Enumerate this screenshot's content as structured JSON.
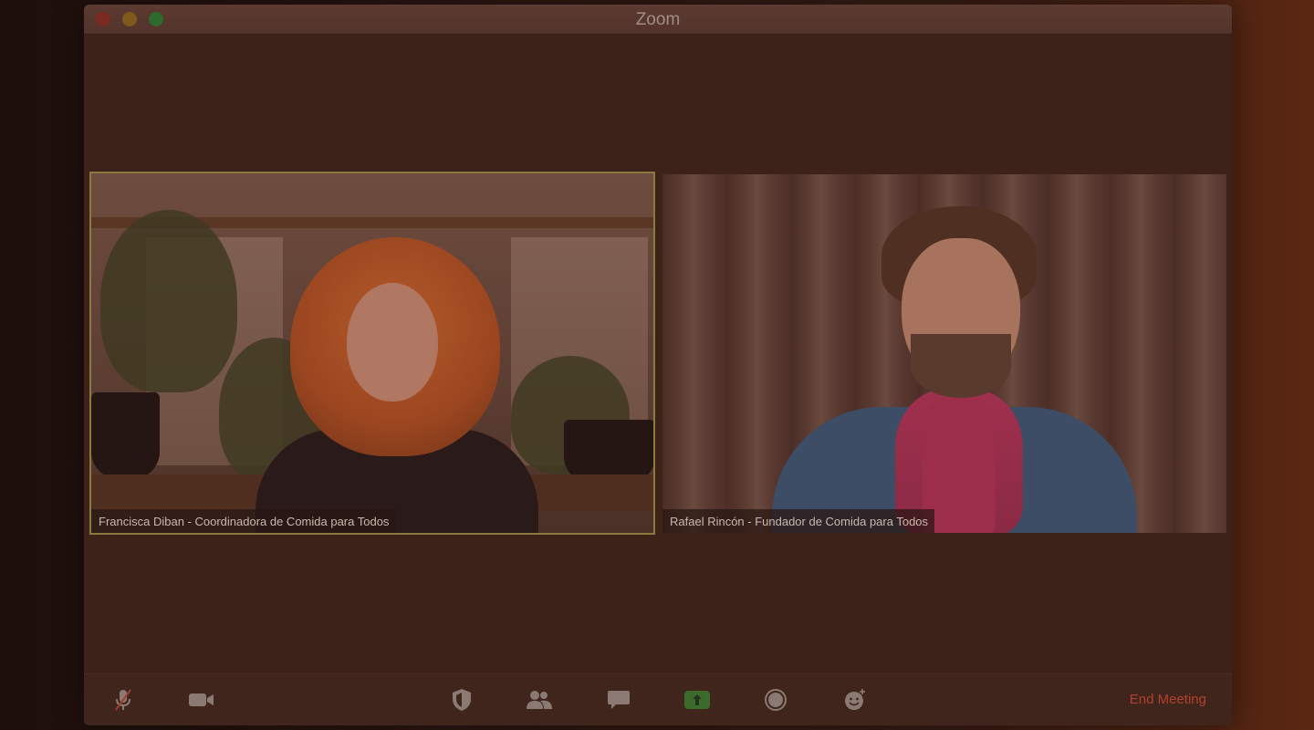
{
  "window": {
    "title": "Zoom"
  },
  "participants": [
    {
      "name_label": "Francisca Diban - Coordinadora de Comida para Todos",
      "active_speaker": true
    },
    {
      "name_label": "Rafael Rincón - Fundador de Comida para Todos",
      "active_speaker": false
    }
  ],
  "toolbar": {
    "icons": [
      "microphone-muted-icon",
      "video-camera-icon",
      "security-shield-icon",
      "participants-icon",
      "chat-icon",
      "share-screen-icon",
      "record-icon",
      "reactions-icon"
    ],
    "end_meeting_label": "End Meeting"
  },
  "colors": {
    "active_speaker_border": "#8a7a3d",
    "share_button": "#3c6b2c",
    "end_meeting_text": "#b3402e"
  }
}
